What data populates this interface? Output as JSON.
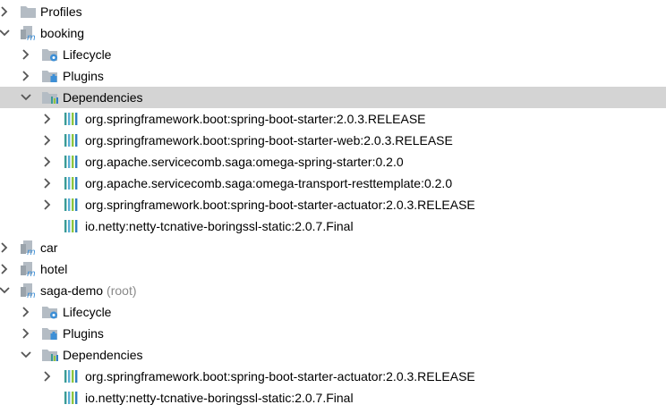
{
  "rows": [
    {
      "label": "Profiles",
      "level": 0,
      "arrow": "collapsed",
      "icon": "profiles-folder-icon"
    },
    {
      "label": "booking",
      "level": 0,
      "arrow": "expanded",
      "icon": "maven-module-icon"
    },
    {
      "label": "Lifecycle",
      "level": 1,
      "arrow": "collapsed",
      "icon": "lifecycle-folder-icon"
    },
    {
      "label": "Plugins",
      "level": 1,
      "arrow": "collapsed",
      "icon": "plugins-folder-icon"
    },
    {
      "label": "Dependencies",
      "level": 1,
      "arrow": "expanded",
      "icon": "dependencies-folder-icon",
      "selected": true
    },
    {
      "label": "org.springframework.boot:spring-boot-starter:2.0.3.RELEASE",
      "level": 2,
      "arrow": "collapsed",
      "icon": "library-icon"
    },
    {
      "label": "org.springframework.boot:spring-boot-starter-web:2.0.3.RELEASE",
      "level": 2,
      "arrow": "collapsed",
      "icon": "library-icon"
    },
    {
      "label": "org.apache.servicecomb.saga:omega-spring-starter:0.2.0",
      "level": 2,
      "arrow": "collapsed",
      "icon": "library-icon"
    },
    {
      "label": "org.apache.servicecomb.saga:omega-transport-resttemplate:0.2.0",
      "level": 2,
      "arrow": "collapsed",
      "icon": "library-icon"
    },
    {
      "label": "org.springframework.boot:spring-boot-starter-actuator:2.0.3.RELEASE",
      "level": 2,
      "arrow": "collapsed",
      "icon": "library-icon"
    },
    {
      "label": "io.netty:netty-tcnative-boringssl-static:2.0.7.Final",
      "level": 2,
      "arrow": "none",
      "icon": "library-icon"
    },
    {
      "label": "car",
      "level": 0,
      "arrow": "collapsed",
      "icon": "maven-module-icon"
    },
    {
      "label": "hotel",
      "level": 0,
      "arrow": "collapsed",
      "icon": "maven-module-icon"
    },
    {
      "label": "saga-demo",
      "suffix": "(root)",
      "level": 0,
      "arrow": "expanded",
      "icon": "maven-module-icon"
    },
    {
      "label": "Lifecycle",
      "level": 1,
      "arrow": "collapsed",
      "icon": "lifecycle-folder-icon"
    },
    {
      "label": "Plugins",
      "level": 1,
      "arrow": "collapsed",
      "icon": "plugins-folder-icon"
    },
    {
      "label": "Dependencies",
      "level": 1,
      "arrow": "expanded",
      "icon": "dependencies-folder-icon"
    },
    {
      "label": "org.springframework.boot:spring-boot-starter-actuator:2.0.3.RELEASE",
      "level": 2,
      "arrow": "collapsed",
      "icon": "library-icon"
    },
    {
      "label": "io.netty:netty-tcnative-boringssl-static:2.0.7.Final",
      "level": 2,
      "arrow": "none",
      "icon": "library-icon"
    }
  ],
  "colors": {
    "selection": "#d4d4d4",
    "folder": "#b4bcc4",
    "gear": "#3d8fd6",
    "library_bars": [
      "#3a9b96",
      "#5aaed6",
      "#8dc63f",
      "#2e7fc1"
    ],
    "module_m": "#3d8fd6",
    "root_suffix": "#8a8a8a"
  }
}
